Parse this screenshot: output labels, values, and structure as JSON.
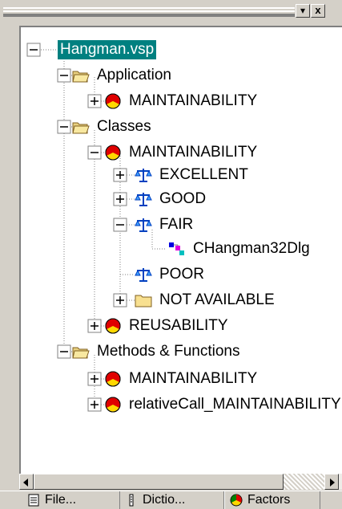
{
  "window": {
    "restore_glyph": "▾",
    "close_glyph": "x"
  },
  "tree": {
    "root": "Hangman.vsp",
    "application": "Application",
    "application_maintainability": "MAINTAINABILITY",
    "classes": "Classes",
    "classes_maintainability": "MAINTAINABILITY",
    "excellent": "EXCELLENT",
    "good": "GOOD",
    "fair": "FAIR",
    "fair_child": "CHangman32Dlg",
    "poor": "POOR",
    "not_available": "NOT AVAILABLE",
    "reusability": "REUSABILITY",
    "methods": "Methods & Functions",
    "methods_maintainability": "MAINTAINABILITY",
    "relative_call": "relativeCall_MAINTAINABILITY"
  },
  "tabs": [
    {
      "label": "File...",
      "icon": "file-icon"
    },
    {
      "label": "Dictio...",
      "icon": "dictionary-icon"
    },
    {
      "label": "Factors",
      "icon": "factors-icon"
    }
  ],
  "colors": {
    "selection": "#008080",
    "face": "#d4d0c8"
  }
}
